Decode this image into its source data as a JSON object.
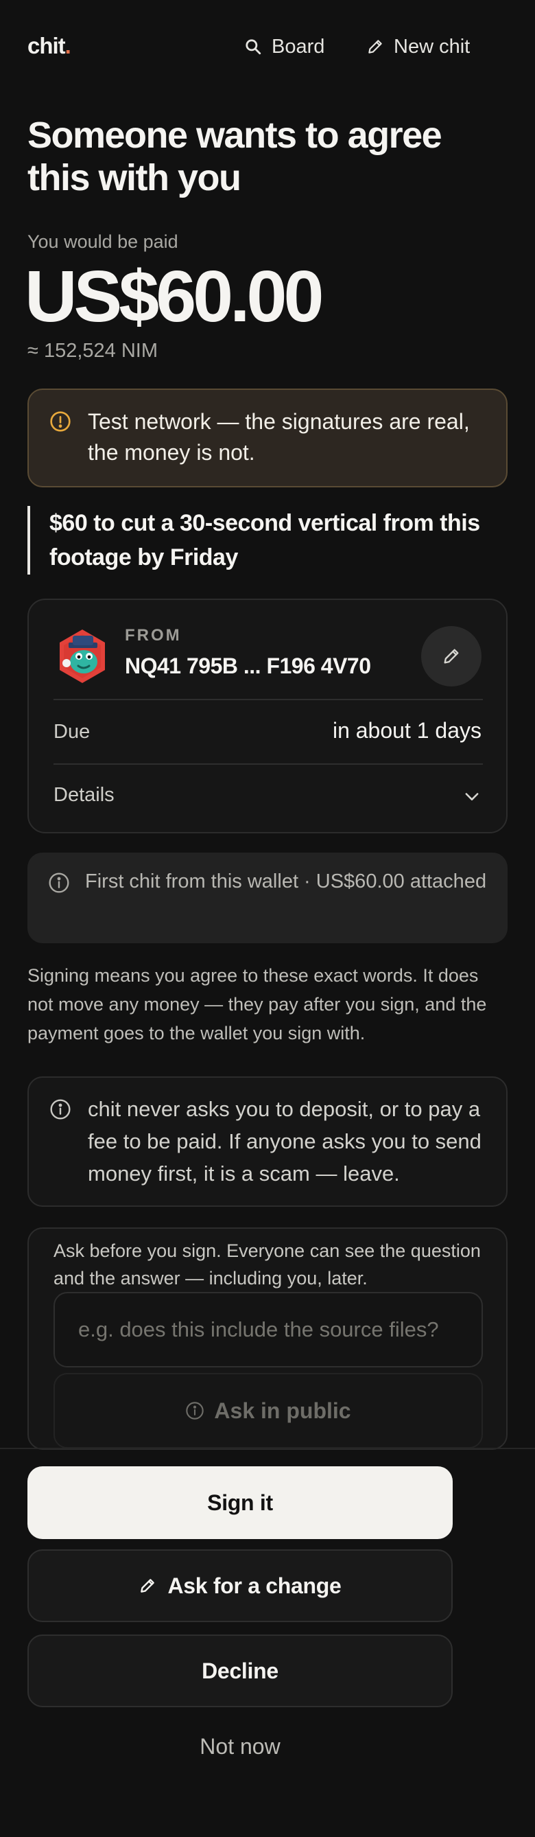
{
  "header": {
    "logo_text": "chit",
    "logo_dot": ".",
    "board_label": "Board",
    "new_chit_label": "New chit"
  },
  "offer": {
    "title": "Someone wants to agree this with you",
    "paid_label": "You would be paid",
    "amount": "US$60.00",
    "nim_amount": "≈ 152,524 NIM"
  },
  "warning": {
    "text": "Test network — the signatures are real, the money is not."
  },
  "quote": {
    "text": "$60 to cut a 30-second vertical from this footage by Friday"
  },
  "card": {
    "from_label": "FROM",
    "from_value": "NQ41 795B ... F196 4V70",
    "due_label": "Due",
    "due_value": "in about 1 days",
    "details_label": "Details"
  },
  "info": {
    "text": "First chit from this wallet · US$60.00 attached"
  },
  "sign_note": "Signing means you agree to these exact words. It does not move any money — they pay after you sign, and the payment goes to the wallet you sign with.",
  "scam": {
    "text": "chit never asks you to deposit, or to pay a fee to be paid. If anyone asks you to send money first, it is a scam — leave."
  },
  "ask": {
    "text": "Ask before you sign. Everyone can see the question and the answer — including you, later.",
    "placeholder": "e.g. does this include the source files?",
    "button_label": "Ask in public"
  },
  "actions": {
    "sign_label": "Sign it",
    "change_label": "Ask for a change",
    "decline_label": "Decline",
    "not_now_label": "Not now"
  },
  "colors": {
    "background": "#111111",
    "accent_dot": "#e2704a",
    "warning_bg": "#2d2721",
    "warning_icon": "#e8a93c"
  }
}
